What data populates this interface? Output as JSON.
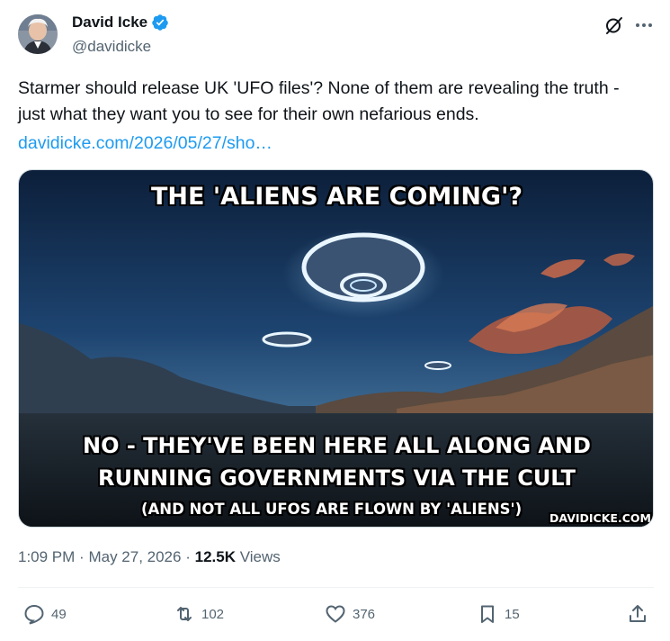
{
  "author": {
    "display_name": "David Icke",
    "handle": "@davidicke",
    "verified_icon": "verified-badge-icon"
  },
  "tweet": {
    "text": "Starmer should release UK 'UFO files'? None of them are revealing the truth - just what they want you to see for their own nefarious ends.",
    "link": "davidicke.com/2026/05/27/sho…"
  },
  "media": {
    "caption_top": "THE 'ALIENS ARE COMING'?",
    "caption_bottom_1": "NO - THEY'VE BEEN HERE ALL ALONG AND",
    "caption_bottom_2": "RUNNING GOVERNMENTS VIA THE CULT",
    "caption_bottom_3": "(AND NOT ALL UFOS ARE FLOWN BY 'ALIENS')",
    "watermark": "DAVIDICKE.COM"
  },
  "meta": {
    "time": "1:09 PM",
    "separator": "·",
    "date": "May 27, 2026",
    "views_count": "12.5K",
    "views_label": "Views"
  },
  "actions": {
    "replies": "49",
    "reposts": "102",
    "likes": "376",
    "bookmarks": "15"
  },
  "colors": {
    "accent": "#1d9bf0",
    "secondary_text": "#536471",
    "primary_text": "#0f1419"
  }
}
